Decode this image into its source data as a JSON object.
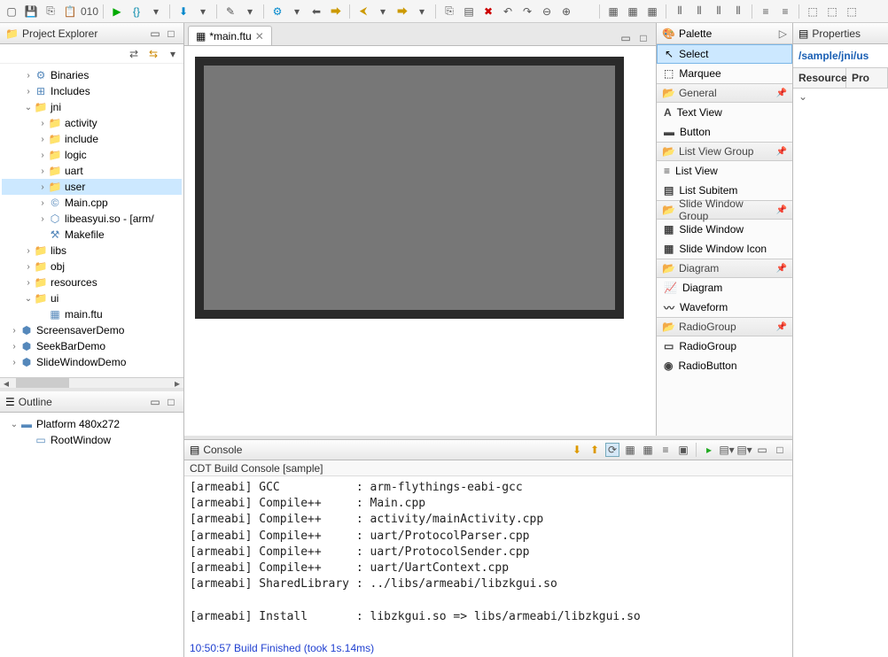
{
  "toolbar_icons": [
    "new",
    "save",
    "save-all",
    "paste",
    "binary",
    "sep",
    "run",
    "debug",
    "dropdown",
    "sep",
    "download",
    "dropdown",
    "sep",
    "wand",
    "dropdown",
    "sep",
    "torch",
    "dropdown",
    "back",
    "fwd-yellow",
    "sep",
    "back-yellow",
    "dropdown",
    "fwd-yellow",
    "dropdown",
    "sep",
    "copy",
    "doc",
    "x-red",
    "undo",
    "redo",
    "zoom-out",
    "zoom-in",
    "blank",
    "sep",
    "layout1",
    "layout2",
    "layout3",
    "sep",
    "align1",
    "align2",
    "align3",
    "align4",
    "sep",
    "dist1",
    "dist2",
    "sep",
    "size1",
    "size2",
    "size3"
  ],
  "project_explorer": {
    "title": "Project Explorer",
    "tree": [
      {
        "indent": 1,
        "arrow": ">",
        "icon": "bin",
        "label": "Binaries"
      },
      {
        "indent": 1,
        "arrow": ">",
        "icon": "inc",
        "label": "Includes"
      },
      {
        "indent": 1,
        "arrow": "v",
        "icon": "folder",
        "label": "jni"
      },
      {
        "indent": 2,
        "arrow": ">",
        "icon": "folder",
        "label": "activity"
      },
      {
        "indent": 2,
        "arrow": ">",
        "icon": "folder",
        "label": "include"
      },
      {
        "indent": 2,
        "arrow": ">",
        "icon": "folder",
        "label": "logic"
      },
      {
        "indent": 2,
        "arrow": ">",
        "icon": "folder",
        "label": "uart"
      },
      {
        "indent": 2,
        "arrow": ">",
        "icon": "folder",
        "label": "user",
        "selected": true
      },
      {
        "indent": 2,
        "arrow": ">",
        "icon": "cpp",
        "label": "Main.cpp"
      },
      {
        "indent": 2,
        "arrow": ">",
        "icon": "so",
        "label": "libeasyui.so - [arm/"
      },
      {
        "indent": 2,
        "arrow": "",
        "icon": "make",
        "label": "Makefile"
      },
      {
        "indent": 1,
        "arrow": ">",
        "icon": "folder",
        "label": "libs"
      },
      {
        "indent": 1,
        "arrow": ">",
        "icon": "folder",
        "label": "obj"
      },
      {
        "indent": 1,
        "arrow": ">",
        "icon": "folder",
        "label": "resources"
      },
      {
        "indent": 1,
        "arrow": "v",
        "icon": "folder",
        "label": "ui"
      },
      {
        "indent": 2,
        "arrow": "",
        "icon": "ftu",
        "label": "main.ftu"
      },
      {
        "indent": 0,
        "arrow": ">",
        "icon": "proj",
        "label": "ScreensaverDemo"
      },
      {
        "indent": 0,
        "arrow": ">",
        "icon": "proj",
        "label": "SeekBarDemo"
      },
      {
        "indent": 0,
        "arrow": ">",
        "icon": "proj",
        "label": "SlideWindowDemo"
      }
    ]
  },
  "outline": {
    "title": "Outline",
    "tree": [
      {
        "indent": 0,
        "arrow": "v",
        "icon": "platform",
        "label": "Platform 480x272"
      },
      {
        "indent": 1,
        "arrow": "",
        "icon": "window",
        "label": "RootWindow"
      }
    ]
  },
  "editor": {
    "tab_label": "*main.ftu"
  },
  "palette": {
    "title": "Palette",
    "tools": [
      {
        "icon": "cursor",
        "label": "Select",
        "selected": true
      },
      {
        "icon": "marquee",
        "label": "Marquee"
      }
    ],
    "groups": [
      {
        "title": "General",
        "items": [
          {
            "icon": "A",
            "label": "Text View"
          },
          {
            "icon": "btn",
            "label": "Button"
          }
        ]
      },
      {
        "title": "List View Group",
        "items": [
          {
            "icon": "list",
            "label": "List View"
          },
          {
            "icon": "subitem",
            "label": "List Subitem"
          }
        ]
      },
      {
        "title": "Slide Window Group",
        "items": [
          {
            "icon": "grid",
            "label": "Slide Window"
          },
          {
            "icon": "grid",
            "label": "Slide Window Icon"
          }
        ]
      },
      {
        "title": "Diagram",
        "items": [
          {
            "icon": "chart",
            "label": "Diagram"
          },
          {
            "icon": "wave",
            "label": "Waveform"
          }
        ]
      },
      {
        "title": "RadioGroup",
        "items": [
          {
            "icon": "rect",
            "label": "RadioGroup"
          },
          {
            "icon": "radio",
            "label": "RadioButton"
          }
        ]
      }
    ]
  },
  "console": {
    "title": "Console",
    "subtitle": "CDT Build Console [sample]",
    "lines": [
      "[armeabi] GCC           : arm-flythings-eabi-gcc",
      "[armeabi] Compile++     : Main.cpp",
      "[armeabi] Compile++     : activity/mainActivity.cpp",
      "[armeabi] Compile++     : uart/ProtocolParser.cpp",
      "[armeabi] Compile++     : uart/ProtocolSender.cpp",
      "[armeabi] Compile++     : uart/UartContext.cpp",
      "[armeabi] SharedLibrary : ../libs/armeabi/libzkgui.so",
      "",
      "[armeabi] Install       : libzkgui.so => libs/armeabi/libzkgui.so",
      ""
    ],
    "finish": "10:50:57 Build Finished (took 1s.14ms)"
  },
  "properties": {
    "title": "Properties",
    "path": "/sample/jni/us",
    "col1": "Resource",
    "col2": "Pro"
  }
}
